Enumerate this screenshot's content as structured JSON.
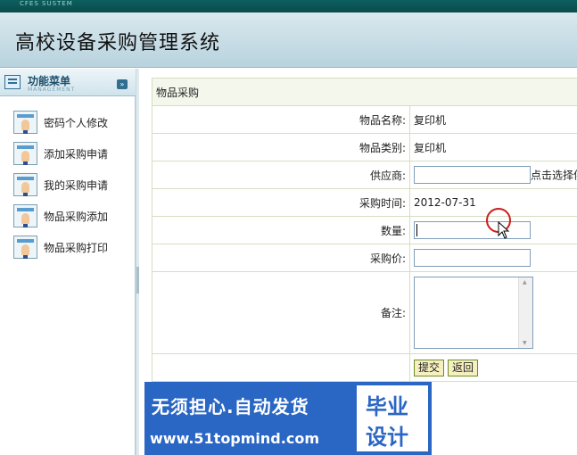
{
  "topbar": {
    "text": "CFES SUSTEM"
  },
  "header": {
    "title": "高校设备采购管理系统"
  },
  "menu": {
    "title": "功能菜单",
    "subtitle": "MANAGEMENT",
    "items": [
      {
        "label": "密码个人修改"
      },
      {
        "label": "添加采购申请"
      },
      {
        "label": "我的采购申请"
      },
      {
        "label": "物品采购添加"
      },
      {
        "label": "物品采购打印"
      }
    ]
  },
  "form": {
    "caption": "物品采购",
    "fields": {
      "name_label": "物品名称:",
      "name_value": "复印机",
      "category_label": "物品类别:",
      "category_value": "复印机",
      "supplier_label": "供应商:",
      "supplier_value": "",
      "supplier_hint": "点击选择供",
      "time_label": "采购时间:",
      "time_value": "2012-07-31",
      "qty_label": "数量:",
      "qty_value": "",
      "price_label": "采购价:",
      "price_value": "",
      "note_label": "备注:",
      "note_value": ""
    },
    "buttons": {
      "submit": "提交",
      "back": "返回"
    }
  },
  "banner": {
    "line1": "无须担心.自动发货",
    "line2": "www.51topmind.com",
    "box1": "毕业",
    "box2": "设计"
  }
}
